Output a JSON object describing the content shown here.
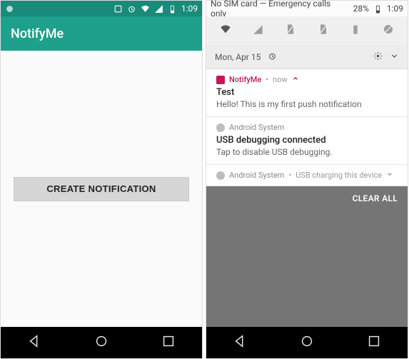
{
  "left": {
    "status": {
      "time": "1:09"
    },
    "appbar": {
      "title": "NotifyMe"
    },
    "main": {
      "create_label": "CREATE NOTIFICATION"
    }
  },
  "right": {
    "status": {
      "carrier": "No SIM card — Emergency calls only",
      "battery": "28%",
      "time": "1:09"
    },
    "qs": {
      "date": "Mon, Apr 15"
    },
    "notifications": [
      {
        "app": "NotifyMe",
        "when": "now",
        "title": "Test",
        "body": "Hello! This is my first push notification"
      },
      {
        "app": "Android System",
        "title": "USB debugging connected",
        "body": "Tap to disable USB debugging."
      },
      {
        "app": "Android System",
        "extra": "USB charging this device"
      }
    ],
    "clear_all": "CLEAR ALL"
  }
}
